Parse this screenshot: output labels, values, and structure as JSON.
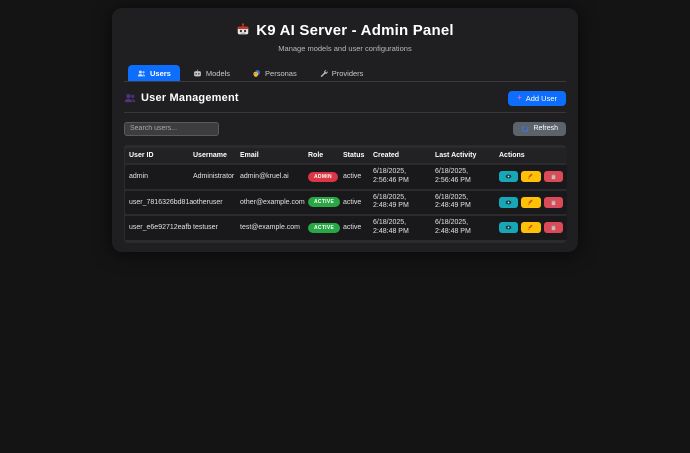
{
  "header": {
    "title": "K9 AI Server - Admin Panel",
    "title_icon": "robot-icon",
    "subtitle": "Manage models and user configurations"
  },
  "tabs": [
    {
      "label": "Users",
      "icon": "users-icon",
      "active": true
    },
    {
      "label": "Models",
      "icon": "robot-icon",
      "active": false
    },
    {
      "label": "Personas",
      "icon": "masks-icon",
      "active": false
    },
    {
      "label": "Providers",
      "icon": "wrench-icon",
      "active": false
    }
  ],
  "user_management": {
    "heading": "User Management",
    "heading_icon": "users-icon",
    "add_user_label": "Add User",
    "add_user_icon": "plus-icon",
    "search_placeholder": "Search users...",
    "refresh_label": "Refresh",
    "refresh_icon": "refresh-icon"
  },
  "table": {
    "headers": [
      "User ID",
      "Username",
      "Email",
      "Role",
      "Status",
      "Created",
      "Last Activity",
      "Actions"
    ],
    "rows": [
      {
        "user_id": "admin",
        "username": "Administrator",
        "email": "admin@kruel.ai",
        "role": "ADMIN",
        "role_color": "#dc3545",
        "status": "active",
        "created": "6/18/2025, 2:56:46 PM",
        "last_activity": "6/18/2025, 2:56:46 PM"
      },
      {
        "user_id": "user_7816326bd81a",
        "username": "otheruser",
        "email": "other@example.com",
        "role": "ACTIVE",
        "role_color": "#28a745",
        "status": "active",
        "created": "6/18/2025, 2:48:49 PM",
        "last_activity": "6/18/2025, 2:48:49 PM"
      },
      {
        "user_id": "user_e6e92712eafb",
        "username": "testuser",
        "email": "test@example.com",
        "role": "ACTIVE",
        "role_color": "#28a745",
        "status": "active",
        "created": "6/18/2025, 2:48:48 PM",
        "last_activity": "6/18/2025, 2:48:48 PM"
      }
    ],
    "actions": [
      {
        "name": "view",
        "icon": "eye-icon",
        "color": "#17a8b8"
      },
      {
        "name": "edit",
        "icon": "pencil-icon",
        "color": "#ffc107"
      },
      {
        "name": "delete",
        "icon": "trash-icon",
        "color": "#dc4a57"
      }
    ]
  },
  "colors": {
    "accent_blue": "#0d6efd",
    "refresh_gray": "#5c636a",
    "badge_admin": "#dc3545",
    "badge_active": "#28a745",
    "page_bg": "#141414",
    "card_bg": "#1f1f21"
  }
}
